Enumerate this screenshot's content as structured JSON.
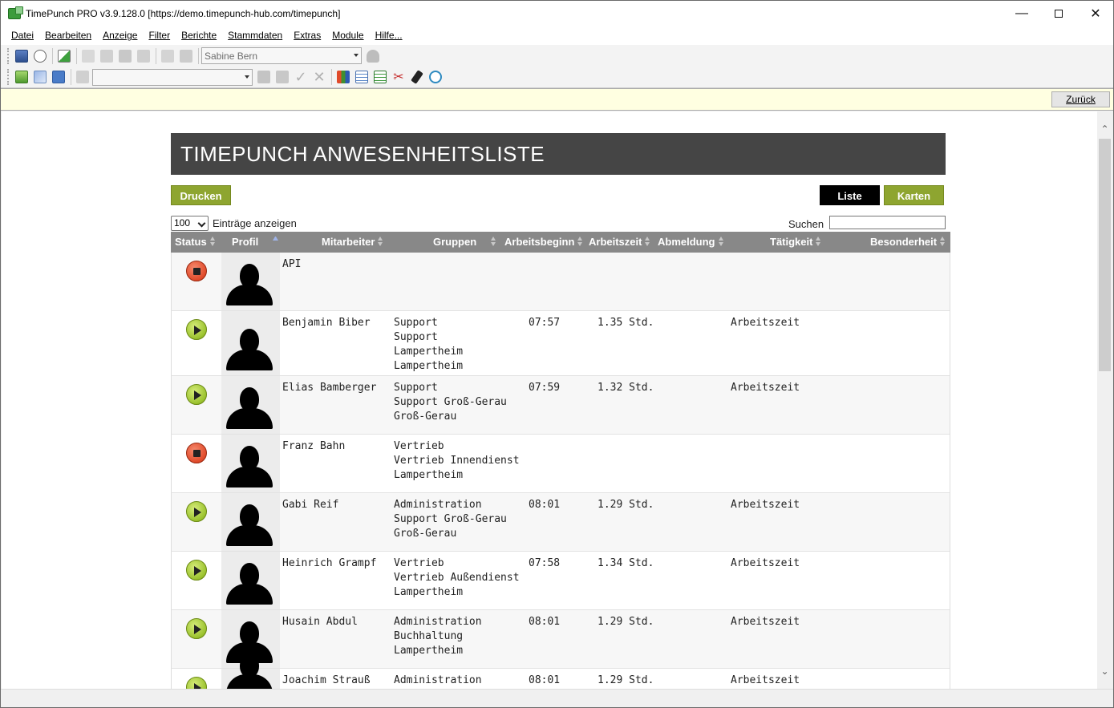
{
  "window": {
    "title": "TimePunch PRO v3.9.128.0 [https://demo.timepunch-hub.com/timepunch]"
  },
  "menu": [
    {
      "label": "Datei"
    },
    {
      "label": "Bearbeiten"
    },
    {
      "label": "Anzeige"
    },
    {
      "label": "Filter"
    },
    {
      "label": "Berichte"
    },
    {
      "label": "Stammdaten"
    },
    {
      "label": "Extras"
    },
    {
      "label": "Module"
    },
    {
      "label": "Hilfe..."
    }
  ],
  "toolbar": {
    "user_combo": "Sabine Bern",
    "second_combo": ""
  },
  "nav": {
    "back_label": "Zurück"
  },
  "page": {
    "title": "TIMEPUNCH ANWESENHEITSLISTE",
    "print_label": "Drucken",
    "list_label": "Liste",
    "cards_label": "Karten",
    "entries_value": "100",
    "entries_label": "Einträge anzeigen",
    "search_label": "Suchen"
  },
  "table": {
    "columns": [
      "Status",
      "Profil",
      "Mitarbeiter",
      "Gruppen",
      "Arbeitsbeginn",
      "Arbeitszeit",
      "Abmeldung",
      "Tätigkeit",
      "Besonderheit"
    ],
    "rows": [
      {
        "status": "stopped",
        "name": "API",
        "groups": [
          "",
          "",
          ""
        ],
        "start": "",
        "time": "",
        "logout": "",
        "activity": "",
        "special": ""
      },
      {
        "status": "running",
        "name": "Benjamin Biber",
        "groups": [
          "Support",
          "Support",
          "Lampertheim",
          "Lampertheim"
        ],
        "start": "07:57",
        "time": "1.35 Std.",
        "logout": "",
        "activity": "Arbeitszeit",
        "special": ""
      },
      {
        "status": "running",
        "name": "Elias Bamberger",
        "groups": [
          "Support",
          "Support Groß-Gerau",
          "Groß-Gerau"
        ],
        "start": "07:59",
        "time": "1.32 Std.",
        "logout": "",
        "activity": "Arbeitszeit",
        "special": ""
      },
      {
        "status": "stopped",
        "name": "Franz Bahn",
        "groups": [
          "Vertrieb",
          "Vertrieb Innendienst",
          "Lampertheim"
        ],
        "start": "",
        "time": "",
        "logout": "",
        "activity": "",
        "special": ""
      },
      {
        "status": "running",
        "name": "Gabi Reif",
        "groups": [
          "Administration",
          "Support Groß-Gerau",
          "Groß-Gerau"
        ],
        "start": "08:01",
        "time": "1.29 Std.",
        "logout": "",
        "activity": "Arbeitszeit",
        "special": ""
      },
      {
        "status": "running",
        "name": "Heinrich Grampf",
        "groups": [
          "Vertrieb",
          "Vertrieb Außendienst",
          "Lampertheim"
        ],
        "start": "07:58",
        "time": "1.34 Std.",
        "logout": "",
        "activity": "Arbeitszeit",
        "special": ""
      },
      {
        "status": "running",
        "name": "Husain Abdul",
        "groups": [
          "Administration",
          "Buchhaltung",
          "Lampertheim"
        ],
        "start": "08:01",
        "time": "1.29 Std.",
        "logout": "",
        "activity": "Arbeitszeit",
        "special": ""
      },
      {
        "status": "running",
        "name": "Joachim Strauß",
        "groups": [
          "Administration",
          "",
          ""
        ],
        "start": "08:01",
        "time": "1.29 Std.",
        "logout": "",
        "activity": "Arbeitszeit",
        "special": ""
      }
    ]
  }
}
